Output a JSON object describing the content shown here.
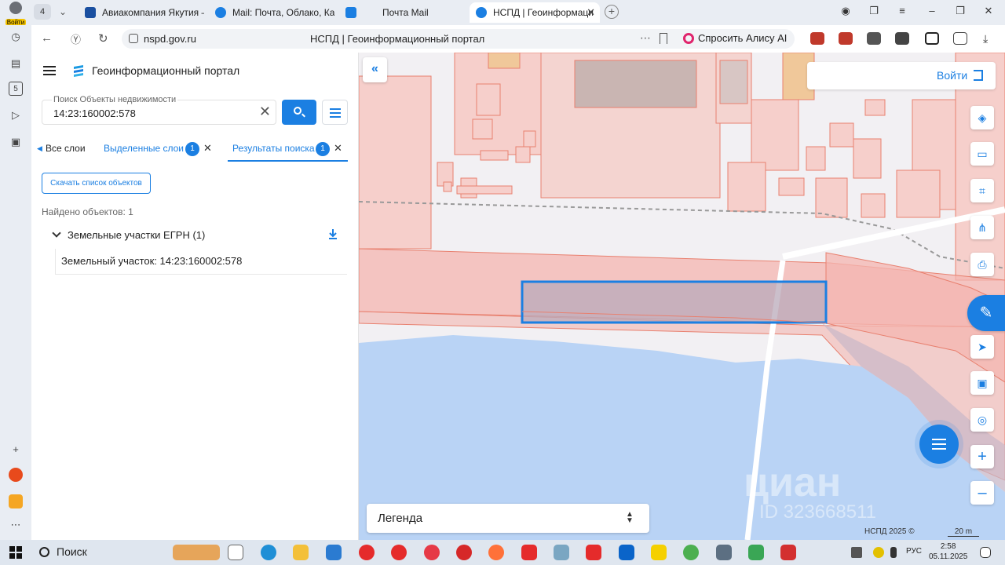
{
  "browser": {
    "account_label": "Войти",
    "tab_count": "4",
    "tabs": [
      {
        "title": "Авиакомпания Якутия –",
        "icon_color": "#1a4fa0"
      },
      {
        "title": "Mail: Почта, Облако, Кале",
        "icon_color": "#1b7fe2"
      },
      {
        "title": "Почта Mail",
        "icon_color": "#1b7fe2"
      },
      {
        "title": "НСПД | Геоинформаци",
        "icon_color": "#1b7fe2"
      }
    ],
    "url_host": "nspd.gov.ru",
    "page_title": "НСПД | Геоинформационный портал",
    "alice_label": "Спросить Алису AI"
  },
  "app": {
    "title": "Геоинформационный портал",
    "search": {
      "label": "Поиск Объекты недвижимости",
      "value": "14:23:160002:578"
    },
    "tabs": {
      "all_layers": "Все слои",
      "selected_layers": "Выделенные слои",
      "selected_count": "1",
      "results": "Результаты поиска",
      "results_count": "1"
    },
    "download_list_label": "Скачать список объектов",
    "found_text": "Найдено объектов: 1",
    "group_label": "Земельные участки ЕГРН (1)",
    "result_item": "Земельный участок: 14:23:160002:578"
  },
  "map": {
    "login_label": "Войти",
    "legend_label": "Легенда",
    "copyright": "НСПД 2025 ©",
    "scale_label": "20 m",
    "watermark": "циан",
    "watermark_id": "ID 323668511",
    "colors": {
      "parcel_fill": "#f4b6b0",
      "parcel_stroke": "#e8806f",
      "water": "#b9d3f5",
      "selected": "#1b7fe2"
    }
  },
  "taskbar": {
    "search_label": "Поиск",
    "lang": "РУС",
    "time": "2:58",
    "date": "05.11.2025"
  }
}
